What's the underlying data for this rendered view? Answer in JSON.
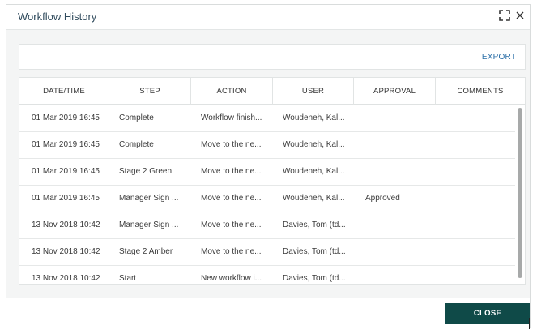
{
  "dialog": {
    "title": "Workflow History",
    "expand_icon": "expand-icon",
    "close_icon": "close-icon"
  },
  "toolbar": {
    "export_label": "EXPORT"
  },
  "table": {
    "columns": [
      "DATE/TIME",
      "STEP",
      "ACTION",
      "USER",
      "APPROVAL",
      "COMMENTS"
    ],
    "rows": [
      {
        "datetime": "01 Mar 2019 16:45",
        "step": "Complete",
        "action": "Workflow finish...",
        "user": "Woudeneh, Kal...",
        "approval": "",
        "comments": ""
      },
      {
        "datetime": "01 Mar 2019 16:45",
        "step": "Complete",
        "action": "Move to the ne...",
        "user": "Woudeneh, Kal...",
        "approval": "",
        "comments": ""
      },
      {
        "datetime": "01 Mar 2019 16:45",
        "step": "Stage 2 Green",
        "action": "Move to the ne...",
        "user": "Woudeneh, Kal...",
        "approval": "",
        "comments": ""
      },
      {
        "datetime": "01 Mar 2019 16:45",
        "step": "Manager Sign ...",
        "action": "Move to the ne...",
        "user": "Woudeneh, Kal...",
        "approval": "Approved",
        "comments": ""
      },
      {
        "datetime": "13 Nov 2018 10:42",
        "step": "Manager Sign ...",
        "action": "Move to the ne...",
        "user": "Davies, Tom (td...",
        "approval": "",
        "comments": ""
      },
      {
        "datetime": "13 Nov 2018 10:42",
        "step": "Stage 2 Amber",
        "action": "Move to the ne...",
        "user": "Davies, Tom (td...",
        "approval": "",
        "comments": ""
      },
      {
        "datetime": "13 Nov 2018 10:42",
        "step": "Start",
        "action": "New workflow i...",
        "user": "Davies, Tom (td...",
        "approval": "",
        "comments": ""
      }
    ]
  },
  "footer": {
    "close_label": "CLOSE"
  },
  "colors": {
    "accent": "#0f4a48",
    "link": "#2b6fa8",
    "title": "#2f4a5c"
  }
}
